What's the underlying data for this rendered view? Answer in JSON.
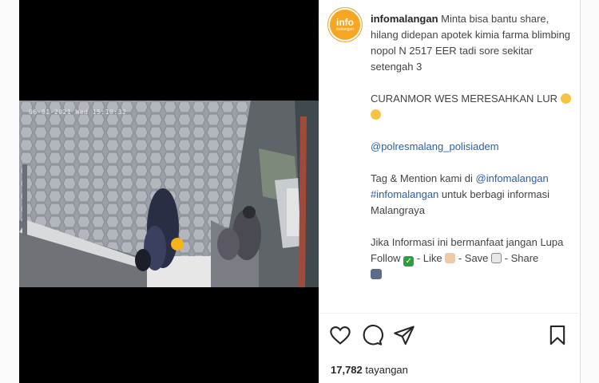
{
  "post": {
    "username": "infomalangan",
    "avatar_text": "info",
    "avatar_subtext": "malangan",
    "caption_line1": " Minta bisa bantu share, hilang didepan apotek kimia farma blimbing nopol N 2517 EER tadi sore sekitar setengah 3",
    "caption_line2": "CURANMOR WES MERESAHKAN LUR",
    "mention_police": "@polresmalang_polisiadem",
    "tag_prefix": "Tag & Mention kami di ",
    "tag_mention": "@infomalangan",
    "tag_hashtag": "#infomalangan",
    "tag_suffix": " untuk berbagi informasi Malangraya",
    "info_text": "Jika Informasi ini bermanfaat jangan Lupa",
    "follow_label": "Follow",
    "like_label": " - Like ",
    "save_label": " - Save ",
    "share_label": " - Share"
  },
  "video": {
    "timestamp": "06-01-2021 Wed 15:10:32"
  },
  "stats": {
    "views_count": "17,782",
    "views_label": "tayangan"
  },
  "colors": {
    "accent_link": "#2b5ea8",
    "brand_orange": "#f6a623",
    "check_green": "#2e9e3e"
  },
  "icons": [
    "heart-icon",
    "comment-icon",
    "share-icon",
    "bookmark-icon"
  ]
}
